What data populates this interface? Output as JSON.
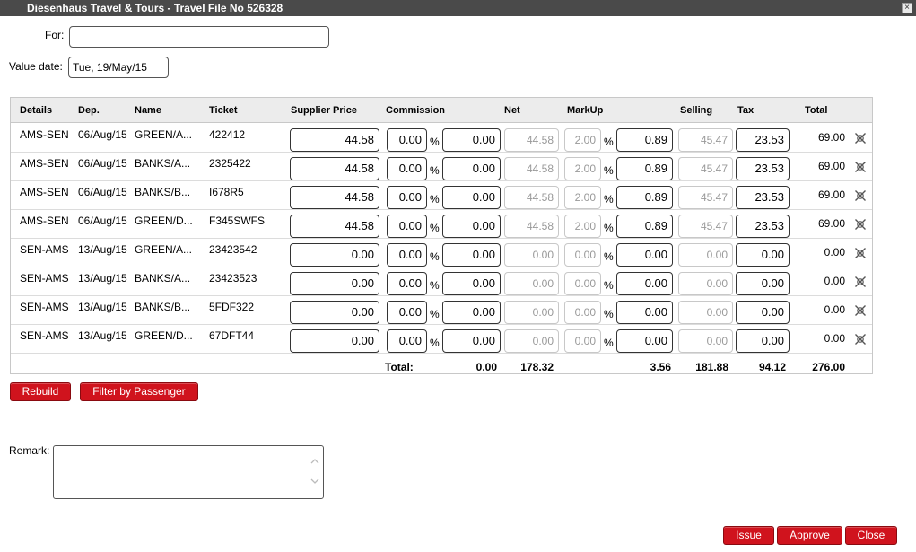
{
  "window": {
    "title": "Diesenhaus Travel & Tours - Travel File No 526328",
    "close_glyph": "×"
  },
  "form": {
    "for_label": "For:",
    "for_value": "",
    "value_date_label": "Value date:",
    "value_date": "Tue, 19/May/15"
  },
  "grid": {
    "headers": {
      "details": "Details",
      "dep": "Dep.",
      "name": "Name",
      "ticket": "Ticket",
      "supplier_price": "Supplier Price",
      "commission": "Commission",
      "net": "Net",
      "markup": "MarkUp",
      "selling": "Selling",
      "tax": "Tax",
      "total": "Total"
    },
    "pct_symbol": "%",
    "rows": [
      {
        "details": "AMS-SEN",
        "dep": "06/Aug/15",
        "name": "GREEN/A...",
        "ticket": "422412",
        "supplier_price": "44.58",
        "comm_pct": "0.00",
        "comm_amt": "0.00",
        "net": "44.58",
        "markup_pct": "2.00",
        "markup_amt": "0.89",
        "selling": "45.47",
        "tax": "23.53",
        "total": "69.00"
      },
      {
        "details": "AMS-SEN",
        "dep": "06/Aug/15",
        "name": "BANKS/A...",
        "ticket": "2325422",
        "supplier_price": "44.58",
        "comm_pct": "0.00",
        "comm_amt": "0.00",
        "net": "44.58",
        "markup_pct": "2.00",
        "markup_amt": "0.89",
        "selling": "45.47",
        "tax": "23.53",
        "total": "69.00"
      },
      {
        "details": "AMS-SEN",
        "dep": "06/Aug/15",
        "name": "BANKS/B...",
        "ticket": "I678R5",
        "supplier_price": "44.58",
        "comm_pct": "0.00",
        "comm_amt": "0.00",
        "net": "44.58",
        "markup_pct": "2.00",
        "markup_amt": "0.89",
        "selling": "45.47",
        "tax": "23.53",
        "total": "69.00"
      },
      {
        "details": "AMS-SEN",
        "dep": "06/Aug/15",
        "name": "GREEN/D...",
        "ticket": "F345SWFS",
        "supplier_price": "44.58",
        "comm_pct": "0.00",
        "comm_amt": "0.00",
        "net": "44.58",
        "markup_pct": "2.00",
        "markup_amt": "0.89",
        "selling": "45.47",
        "tax": "23.53",
        "total": "69.00"
      },
      {
        "details": "SEN-AMS",
        "dep": "13/Aug/15",
        "name": "GREEN/A...",
        "ticket": "23423542",
        "supplier_price": "0.00",
        "comm_pct": "0.00",
        "comm_amt": "0.00",
        "net": "0.00",
        "markup_pct": "0.00",
        "markup_amt": "0.00",
        "selling": "0.00",
        "tax": "0.00",
        "total": "0.00"
      },
      {
        "details": "SEN-AMS",
        "dep": "13/Aug/15",
        "name": "BANKS/A...",
        "ticket": "23423523",
        "supplier_price": "0.00",
        "comm_pct": "0.00",
        "comm_amt": "0.00",
        "net": "0.00",
        "markup_pct": "0.00",
        "markup_amt": "0.00",
        "selling": "0.00",
        "tax": "0.00",
        "total": "0.00"
      },
      {
        "details": "SEN-AMS",
        "dep": "13/Aug/15",
        "name": "BANKS/B...",
        "ticket": "5FDF322",
        "supplier_price": "0.00",
        "comm_pct": "0.00",
        "comm_amt": "0.00",
        "net": "0.00",
        "markup_pct": "0.00",
        "markup_amt": "0.00",
        "selling": "0.00",
        "tax": "0.00",
        "total": "0.00"
      },
      {
        "details": "SEN-AMS",
        "dep": "13/Aug/15",
        "name": "GREEN/D...",
        "ticket": "67DFT44",
        "supplier_price": "0.00",
        "comm_pct": "0.00",
        "comm_amt": "0.00",
        "net": "0.00",
        "markup_pct": "0.00",
        "markup_amt": "0.00",
        "selling": "0.00",
        "tax": "0.00",
        "total": "0.00"
      }
    ],
    "totals": {
      "label": "Total:",
      "commission": "0.00",
      "net": "178.32",
      "markup": "3.56",
      "selling": "181.88",
      "tax": "94.12",
      "total": "276.00"
    }
  },
  "buttons": {
    "rebuild": "Rebuild",
    "filter_by_passenger": "Filter by Passenger",
    "issue": "Issue",
    "approve": "Approve",
    "close": "Close"
  },
  "remark": {
    "label": "Remark:",
    "value": ""
  },
  "icons": {
    "delete_row": "x-circle-icon",
    "scroll_up": "chevron-up-icon",
    "scroll_down": "chevron-down-icon"
  },
  "colors": {
    "titlebar": "#4a4a4a",
    "button": "#d0131d"
  }
}
